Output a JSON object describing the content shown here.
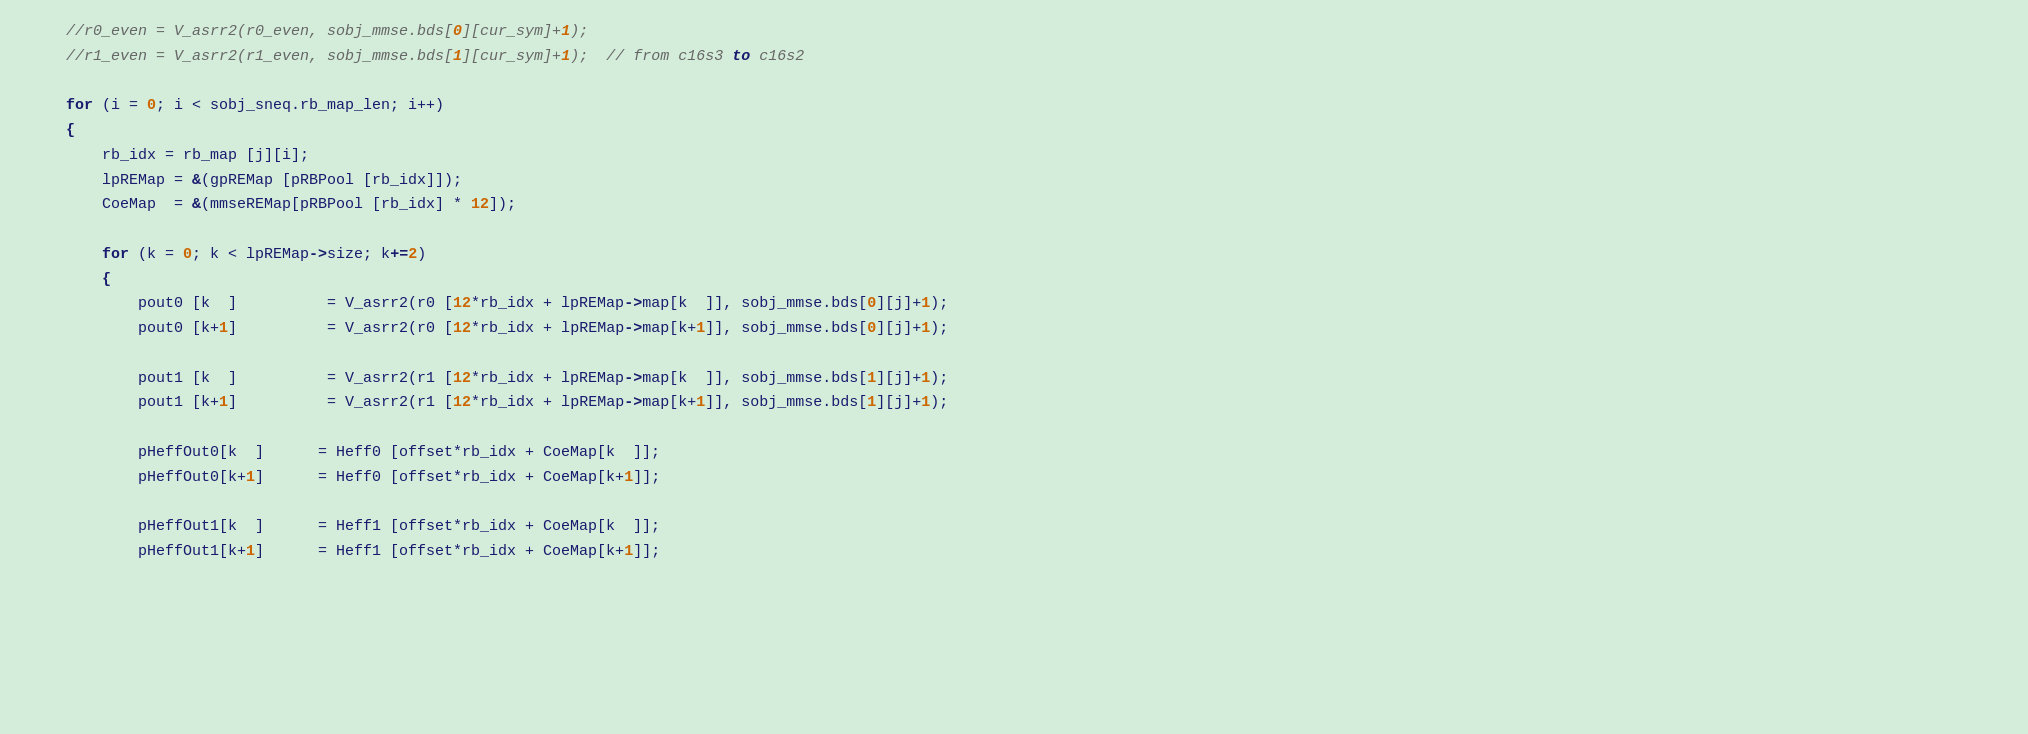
{
  "code": {
    "background": "#d4edda",
    "lines": [
      "    //r0_even = V_asrr2(r0_even, sobj_mmse.bds[0][cur_sym]+1);",
      "    //r1_even = V_asrr2(r1_even, sobj_mmse.bds[1][cur_sym]+1);  // from c16s3 to c16s2",
      "",
      "    for (i = 0; i < sobj_sneq.rb_map_len; i++)",
      "    {",
      "        rb_idx = rb_map [j][i];",
      "        lpREMap = &(gpREMap [pRBPool [rb_idx]]);",
      "        CoeMap  = &(mmseREMap[pRBPool [rb_idx] * 12]);",
      "",
      "        for (k = 0; k < lpREMap->size; k+=2)",
      "        {",
      "            pout0 [k  ]          = V_asrr2(r0 [12*rb_idx + lpREMap->map[k  ]], sobj_mmse.bds[0][j]+1);",
      "            pout0 [k+1]          = V_asrr2(r0 [12*rb_idx + lpREMap->map[k+1]], sobj_mmse.bds[0][j]+1);",
      "",
      "            pout1 [k  ]          = V_asrr2(r1 [12*rb_idx + lpREMap->map[k  ]], sobj_mmse.bds[1][j]+1);",
      "            pout1 [k+1]          = V_asrr2(r1 [12*rb_idx + lpREMap->map[k+1]], sobj_mmse.bds[1][j]+1);",
      "",
      "            pHeffOut0[k  ]      = Heff0 [offset*rb_idx + CoeMap[k  ]];",
      "            pHeffOut0[k+1]      = Heff0 [offset*rb_idx + CoeMap[k+1]];",
      "",
      "            pHeffOut1[k  ]      = Heff1 [offset*rb_idx + CoeMap[k  ]];",
      "            pHeffOut1[k+1]      = Heff1 [offset*rb_idx + CoeMap[k+1]];"
    ]
  }
}
